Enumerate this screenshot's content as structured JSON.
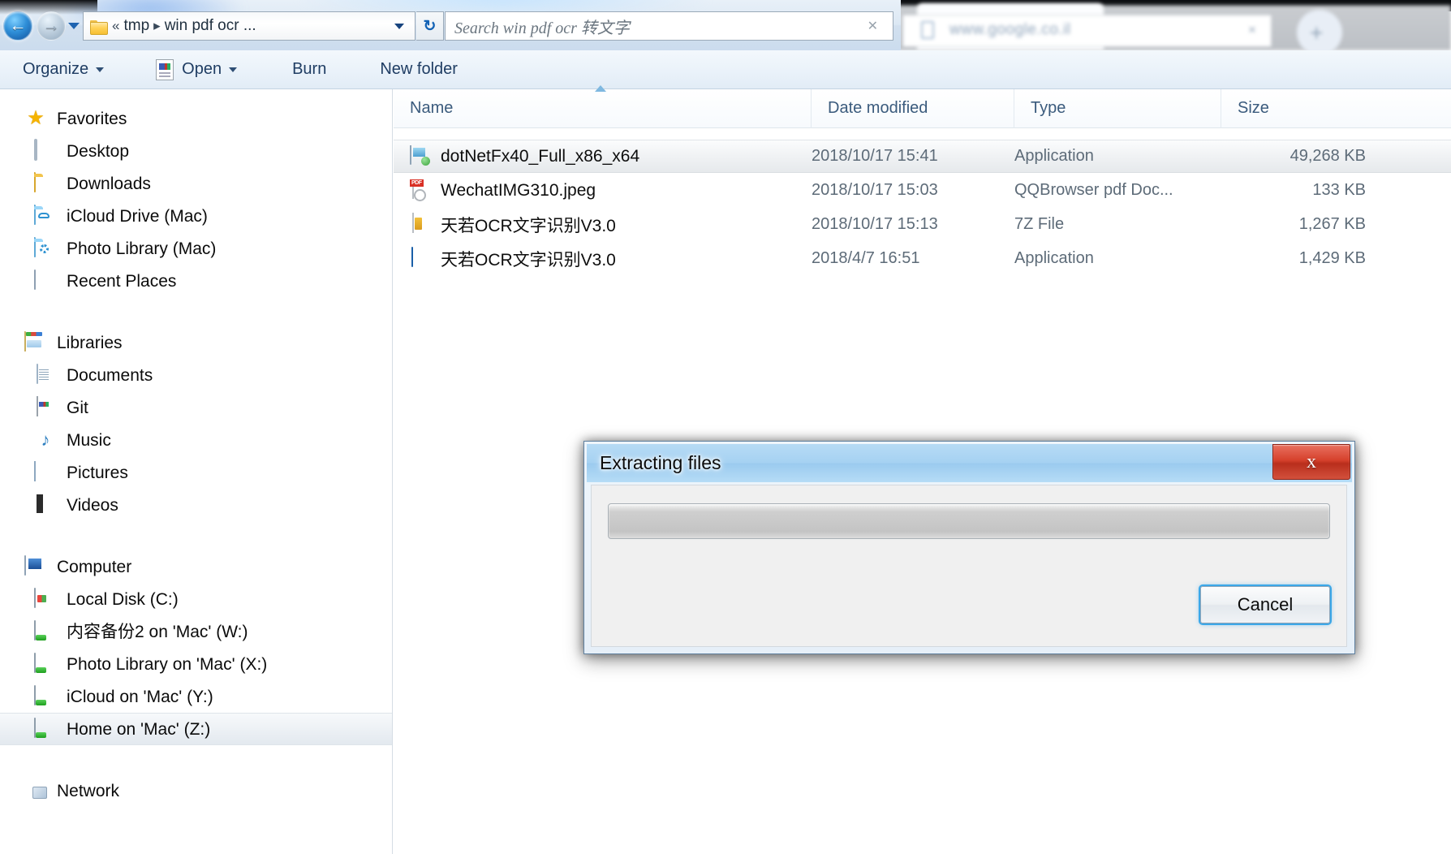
{
  "background_browser": {
    "url_text": "www.google.co.il",
    "close_tab_label": "×",
    "new_tab_label": "+"
  },
  "address_bar": {
    "back_label": "←",
    "forward_label": "→",
    "breadcrumb": {
      "overflow": "«",
      "crumbs": [
        "tmp",
        "win pdf ocr ..."
      ],
      "separator": "▸"
    },
    "refresh_label": "↻",
    "search_placeholder": "Search win pdf ocr 转文字",
    "search_clear_label": "✕"
  },
  "toolbar": {
    "organize_label": "Organize",
    "open_label": "Open",
    "burn_label": "Burn",
    "new_folder_label": "New folder"
  },
  "sidebar": {
    "groups": [
      {
        "header": {
          "label": "Favorites",
          "icon": "star-icon"
        },
        "items": [
          {
            "label": "Desktop",
            "icon": "desktop-icon"
          },
          {
            "label": "Downloads",
            "icon": "folder-icon"
          },
          {
            "label": "iCloud Drive (Mac)",
            "icon": "cloud-folder-icon"
          },
          {
            "label": "Photo Library (Mac)",
            "icon": "photo-folder-icon"
          },
          {
            "label": "Recent Places",
            "icon": "recent-places-icon"
          }
        ]
      },
      {
        "header": {
          "label": "Libraries",
          "icon": "libraries-icon"
        },
        "items": [
          {
            "label": "Documents",
            "icon": "document-icon"
          },
          {
            "label": "Git",
            "icon": "git-icon"
          },
          {
            "label": "Music",
            "icon": "music-icon"
          },
          {
            "label": "Pictures",
            "icon": "pictures-icon"
          },
          {
            "label": "Videos",
            "icon": "videos-icon"
          }
        ]
      },
      {
        "header": {
          "label": "Computer",
          "icon": "computer-icon"
        },
        "items": [
          {
            "label": "Local Disk (C:)",
            "icon": "local-disk-icon",
            "selected": false
          },
          {
            "label": "内容备份2 on 'Mac' (W:)",
            "icon": "network-drive-icon",
            "selected": false
          },
          {
            "label": "Photo Library on 'Mac' (X:)",
            "icon": "network-drive-icon",
            "selected": false
          },
          {
            "label": "iCloud on 'Mac' (Y:)",
            "icon": "network-drive-icon",
            "selected": false
          },
          {
            "label": "Home on 'Mac' (Z:)",
            "icon": "network-drive-icon",
            "selected": true
          }
        ]
      },
      {
        "header": {
          "label": "Network",
          "icon": "network-icon"
        },
        "items": []
      }
    ]
  },
  "file_list": {
    "columns": [
      {
        "key": "name",
        "label": "Name",
        "sort": "ascending"
      },
      {
        "key": "date",
        "label": "Date modified"
      },
      {
        "key": "type",
        "label": "Type"
      },
      {
        "key": "size",
        "label": "Size"
      }
    ],
    "rows": [
      {
        "name": "dotNetFx40_Full_x86_x64",
        "date": "2018/10/17 15:41",
        "type": "Application",
        "size": "49,268 KB",
        "icon": "executable-icon",
        "selected": true
      },
      {
        "name": "WechatIMG310.jpeg",
        "date": "2018/10/17 15:03",
        "type": "QQBrowser pdf Doc...",
        "size": "133 KB",
        "icon": "pdf-document-icon",
        "selected": false
      },
      {
        "name": "天若OCR文字识别V3.0",
        "date": "2018/10/17 15:13",
        "type": "7Z File",
        "size": "1,267 KB",
        "icon": "seven-zip-icon",
        "selected": false
      },
      {
        "name": "天若OCR文字识别V3.0",
        "date": "2018/4/7 16:51",
        "type": "Application",
        "size": "1,429 KB",
        "icon": "application-icon",
        "selected": false
      }
    ]
  },
  "dialog": {
    "title": "Extracting files",
    "close_label": "x",
    "progress_percent": 0,
    "cancel_label": "Cancel"
  },
  "colors": {
    "accent_blue": "#3ba7e8",
    "close_red": "#d6412c",
    "title_bar_blue": "#a6d2f2",
    "selection_gray": "#e6e9ec"
  }
}
